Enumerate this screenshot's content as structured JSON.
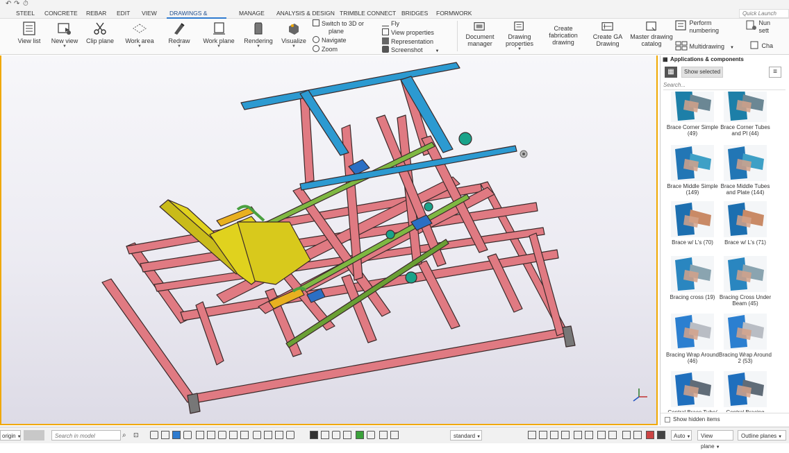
{
  "quick_access": [
    "↶",
    "↷",
    "⏱"
  ],
  "tabs": [
    "STEEL",
    "CONCRETE",
    "REBAR",
    "EDIT",
    "VIEW",
    "DRAWINGS & REPORTS",
    "MANAGE",
    "ANALYSIS & DESIGN",
    "TRIMBLE CONNECT",
    "BRIDGES",
    "FORMWORK"
  ],
  "active_tab": "VIEW",
  "quick_launch_placeholder": "Quick Launch",
  "ribbon": {
    "view_list": "View list",
    "new_view": "New view",
    "clip_plane": "Clip plane",
    "work_area": "Work area",
    "redraw": "Redraw",
    "work_plane": "Work plane",
    "rendering": "Rendering",
    "visualize": "Visualize",
    "switch_3d_line1": "Switch to 3D or",
    "switch_3d_line2": "plane",
    "navigate": "Navigate",
    "zoom": "Zoom",
    "fly": "Fly",
    "view_properties": "View properties",
    "representation": "Representation",
    "screenshot": "Screenshot",
    "document_manager_line1": "Document",
    "document_manager_line2": "manager",
    "drawing_properties_line1": "Drawing",
    "drawing_properties_line2": "properties",
    "create_fab_line1": "Create",
    "create_fab_line2": "fabrication",
    "create_fab_line3": "drawing",
    "create_ga_line1": "Create GA",
    "create_ga_line2": "Drawing",
    "master_line1": "Master drawing",
    "master_line2": "catalog",
    "perform_numbering_line1": "Perform",
    "perform_numbering_line2": "numbering",
    "multidrawing": "Multidrawing",
    "numbering_settings_line1": "Nun",
    "numbering_settings_line2": "sett",
    "change": "Cha"
  },
  "panel": {
    "title": "Applications & components",
    "show_selected": "Show selected",
    "search_placeholder": "Search...",
    "show_hidden_items": "Show hidden items",
    "components": [
      {
        "line1": "Brace Corner Simple",
        "line2": "(49)"
      },
      {
        "line1": "Brace Corner Tubes",
        "line2": "and Pl (44)"
      },
      {
        "line1": "Brace Middle Simple",
        "line2": "(149)"
      },
      {
        "line1": "Brace Middle Tubes",
        "line2": "and Plate (144)"
      },
      {
        "line1": "Brace w/ L's (70)",
        "line2": ""
      },
      {
        "line1": "Brace w/ L's (71)",
        "line2": ""
      },
      {
        "line1": "Bracing cross (19)",
        "line2": ""
      },
      {
        "line1": "Bracing Cross Under",
        "line2": "Beam (45)"
      },
      {
        "line1": "Bracing Wrap Around",
        "line2": "(46)"
      },
      {
        "line1": "Bracing Wrap Around",
        "line2": "2 (53)"
      },
      {
        "line1": "Central Brace Tube/",
        "line2": ""
      },
      {
        "line1": "Central Bracing",
        "line2": ""
      }
    ]
  },
  "status": {
    "origin": "origin",
    "search_model_placeholder": "Search in model",
    "view_filter": "standard",
    "auto": "Auto",
    "view_plane": "View plane",
    "outline_planes": "Outline planes"
  },
  "colors": {
    "frame": "#e07a82",
    "platform": "#2c9ad1",
    "seat": "#e0d21e",
    "rod": "#7fb842",
    "teal": "#1aa38a",
    "accent_tab": "#2e7bcf",
    "viewport_border": "#f0a800"
  }
}
